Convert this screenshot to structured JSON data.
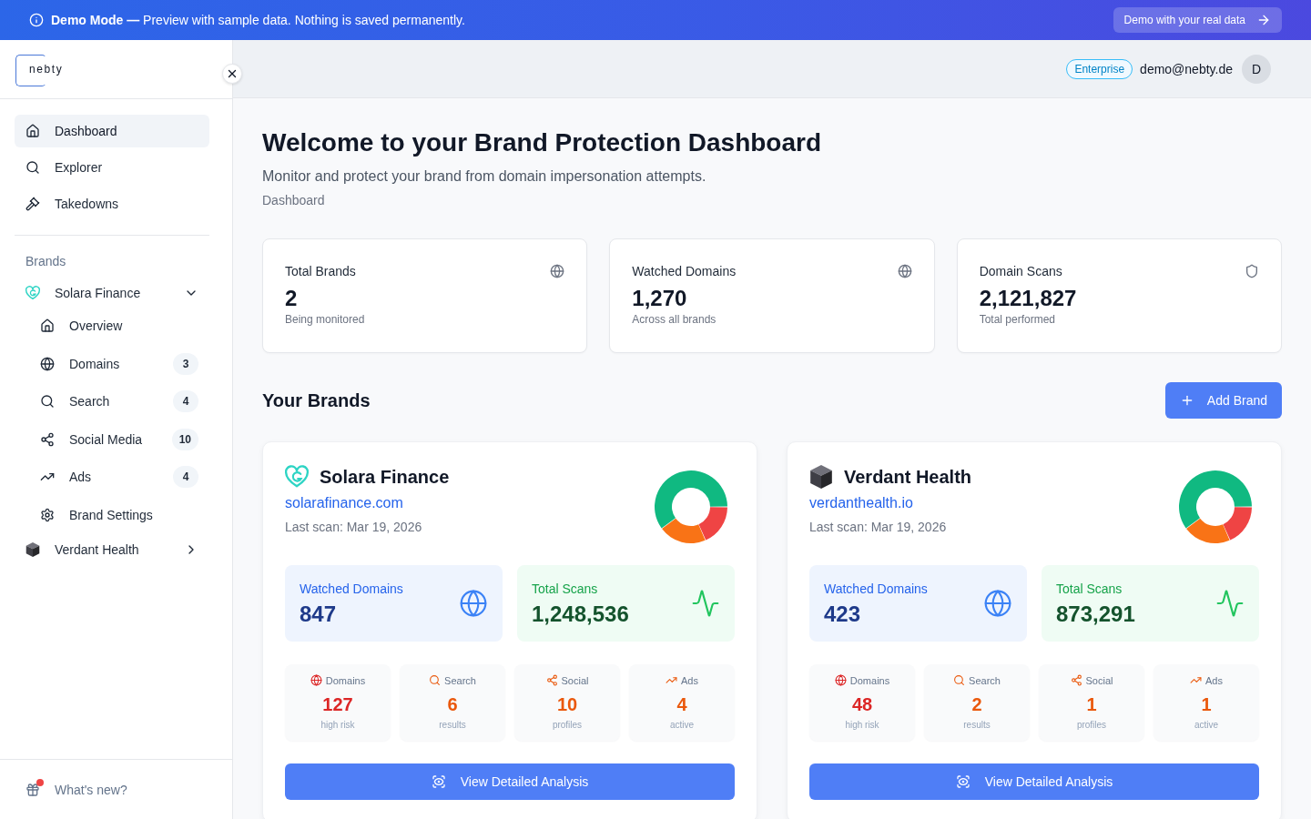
{
  "banner": {
    "message": "**Demo Mode —** Preview with sample data. Nothing is saved permanently.",
    "action": "Demo with your real data"
  },
  "sidebar": {
    "logo": "nebty",
    "nav": [
      {
        "label": "Dashboard",
        "kind": "dashboard",
        "selected": true
      },
      {
        "label": "Explorer",
        "kind": "explorer",
        "selected": false
      },
      {
        "label": "Takedowns",
        "kind": "takedowns",
        "selected": false
      }
    ],
    "brands_heading": "Brands",
    "brands": [
      {
        "name": "Solara Finance",
        "kind": "swirl",
        "expanded": true,
        "children": [
          {
            "label": "Overview",
            "kind": "overview",
            "selected": false
          },
          {
            "label": "Domains",
            "kind": "domains",
            "count": "3",
            "selected": false
          },
          {
            "label": "Search",
            "kind": "search",
            "count": "4",
            "selected": false
          },
          {
            "label": "Social Media",
            "kind": "social",
            "count": "10",
            "selected": false
          },
          {
            "label": "Ads",
            "kind": "ads",
            "count": "4",
            "selected": false
          },
          {
            "label": "Brand Settings",
            "kind": "settings",
            "selected": false
          }
        ]
      },
      {
        "name": "Verdant Health",
        "kind": "cube",
        "expanded": false
      }
    ],
    "footer": {
      "label": "What's new?",
      "unread": true
    }
  },
  "header": {
    "plan": "Enterprise",
    "email": "demo@nebty.de",
    "avatar": "D"
  },
  "page": {
    "title": "Welcome to your Brand Protection Dashboard",
    "subtitle": "Monitor and protect your brand from domain impersonation attempts.",
    "breadcrumb": "Dashboard"
  },
  "stats": [
    {
      "kind": "brands",
      "label": "Total Brands",
      "value": "2",
      "note": "Being monitored"
    },
    {
      "kind": "domains",
      "label": "Watched Domains",
      "value": "1,270",
      "note": "Across all brands"
    },
    {
      "kind": "scans",
      "label": "Domain Scans",
      "value": "2,121,827",
      "note": "Total performed"
    }
  ],
  "brands_section": {
    "title": "Your Brands",
    "action": "Add Brand"
  },
  "brand_cards": [
    {
      "kind": "swirl",
      "name": "Solara Finance",
      "domain": "solarafinance.com",
      "last_scan": "Last scan: Mar 19, 2026",
      "tiles": [
        {
          "kind": "domains",
          "label": "Watched Domains",
          "value": "847"
        },
        {
          "kind": "scans",
          "label": "Total Scans",
          "value": "1,248,536"
        }
      ],
      "risks": [
        {
          "kind": "domains",
          "label": "Domains",
          "value": "127",
          "note": "high risk",
          "color": "#dc2626"
        },
        {
          "kind": "search",
          "label": "Search",
          "value": "6",
          "note": "results",
          "color": "#ea580c"
        },
        {
          "kind": "social",
          "label": "Social",
          "value": "10",
          "note": "profiles",
          "color": "#ea580c"
        },
        {
          "kind": "ads",
          "label": "Ads",
          "value": "4",
          "note": "active",
          "color": "#ea580c"
        }
      ],
      "action": "View Detailed Analysis"
    },
    {
      "kind": "cube",
      "name": "Verdant Health",
      "domain": "verdanthealth.io",
      "last_scan": "Last scan: Mar 19, 2026",
      "tiles": [
        {
          "kind": "domains",
          "label": "Watched Domains",
          "value": "423"
        },
        {
          "kind": "scans",
          "label": "Total Scans",
          "value": "873,291"
        }
      ],
      "risks": [
        {
          "kind": "domains",
          "label": "Domains",
          "value": "48",
          "note": "high risk",
          "color": "#dc2626"
        },
        {
          "kind": "search",
          "label": "Search",
          "value": "2",
          "note": "results",
          "color": "#ea580c"
        },
        {
          "kind": "social",
          "label": "Social",
          "value": "1",
          "note": "profiles",
          "color": "#ea580c"
        },
        {
          "kind": "ads",
          "label": "Ads",
          "value": "1",
          "note": "active",
          "color": "#ea580c"
        }
      ],
      "action": "View Detailed Analysis"
    }
  ]
}
